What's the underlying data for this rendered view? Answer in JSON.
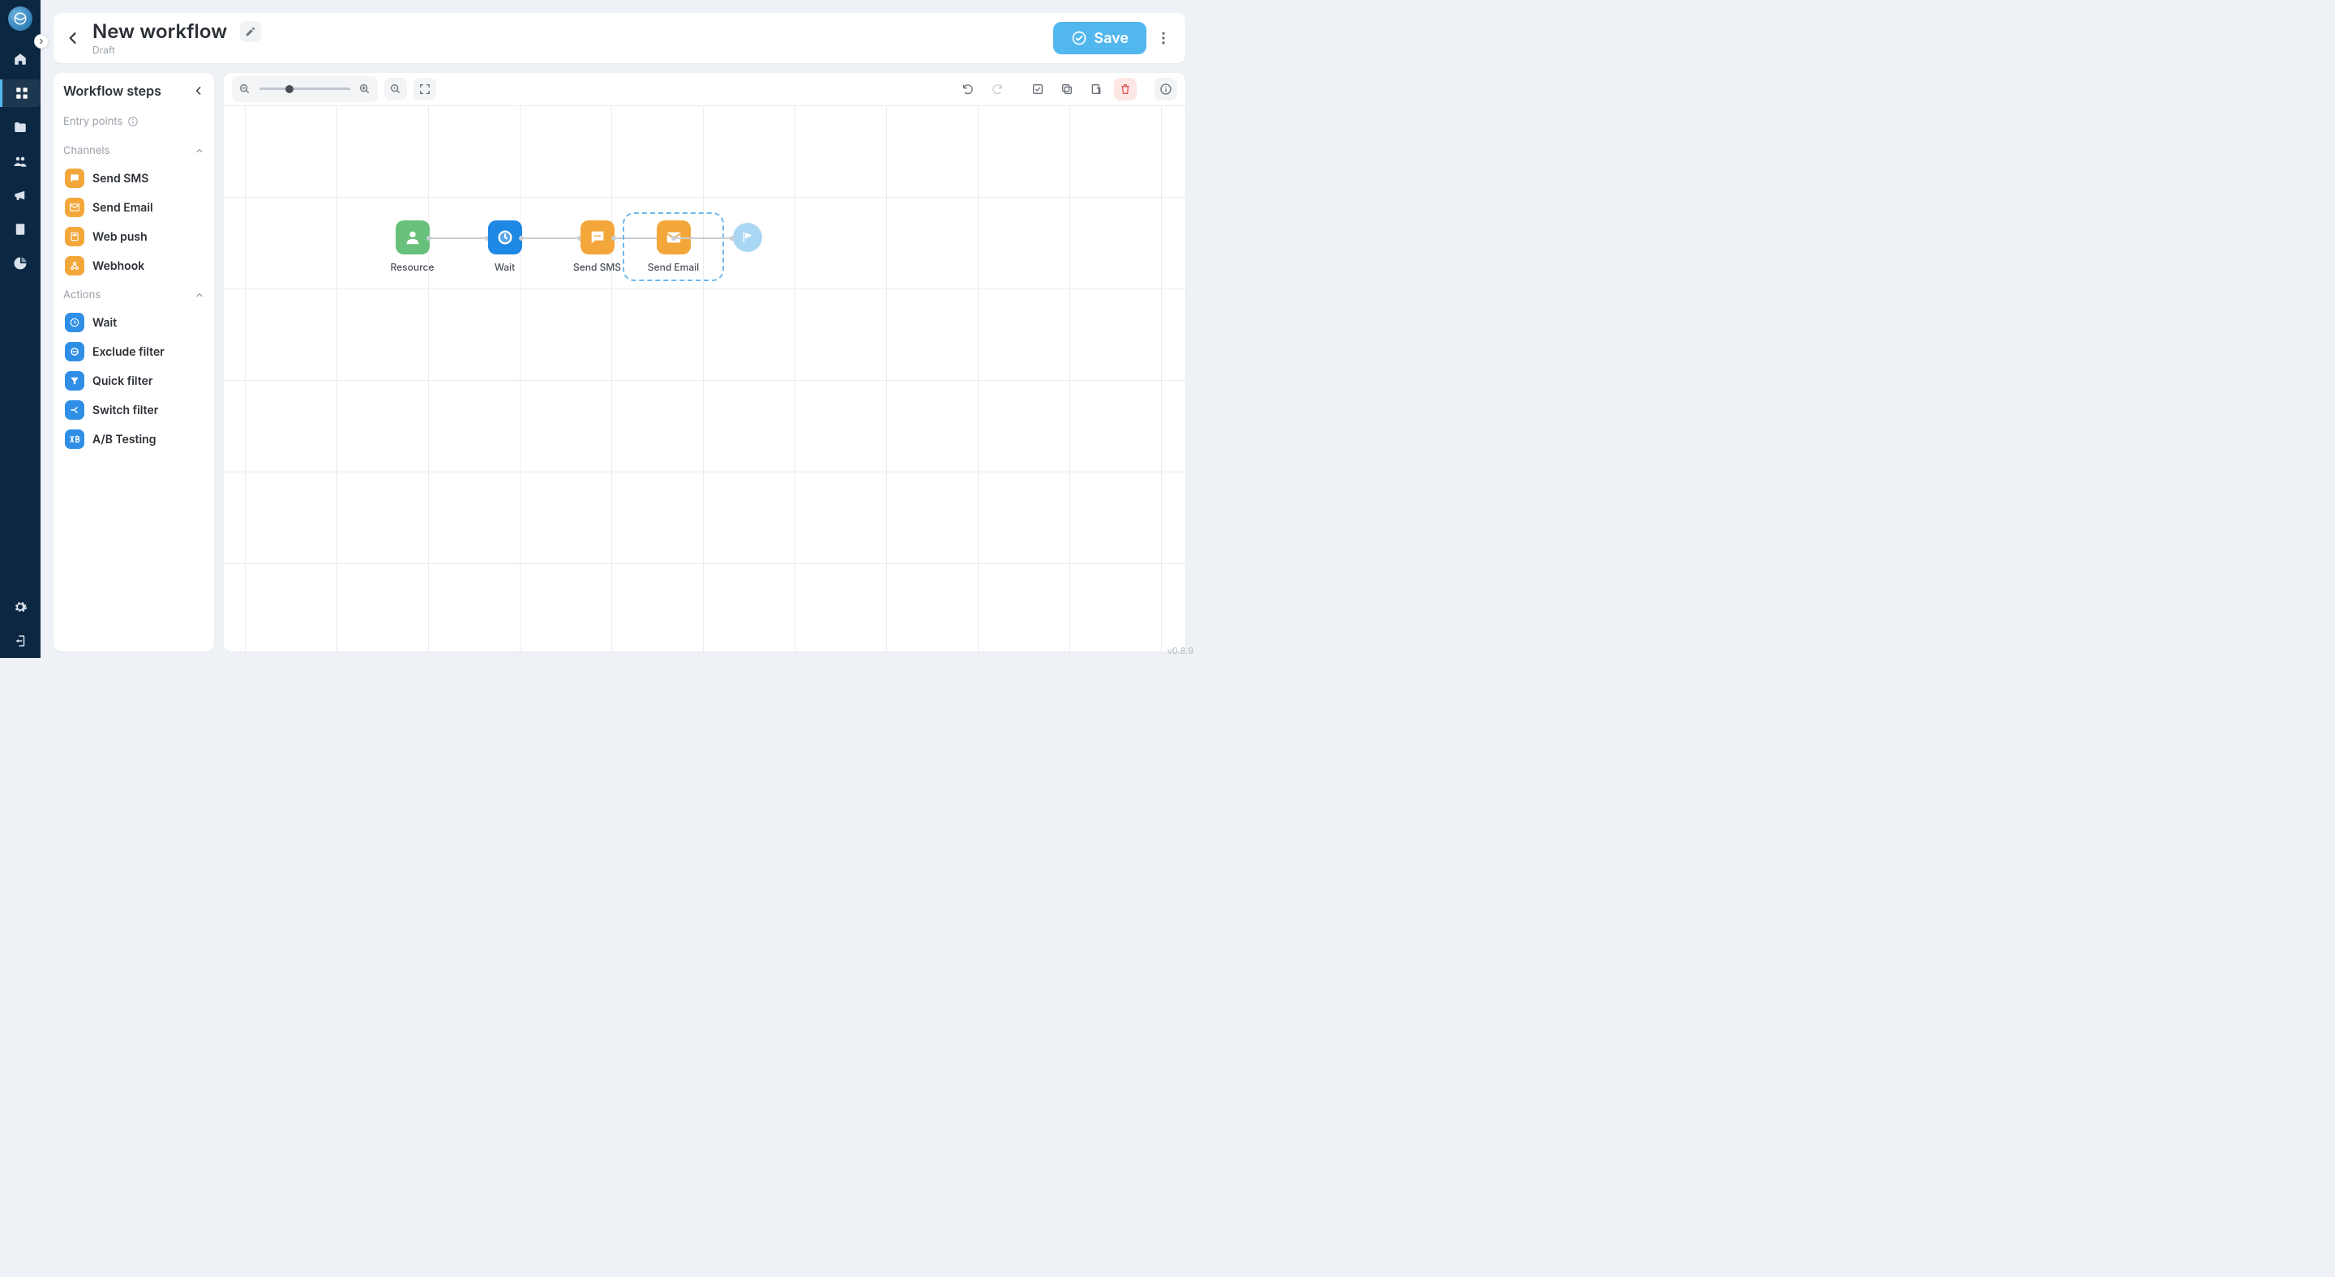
{
  "header": {
    "title": "New workflow",
    "status": "Draft",
    "save_label": "Save"
  },
  "sidepanel": {
    "title": "Workflow steps",
    "entry_points_label": "Entry points",
    "channels_label": "Channels",
    "actions_label": "Actions",
    "channels": [
      {
        "label": "Send SMS",
        "icon": "sms-icon"
      },
      {
        "label": "Send Email",
        "icon": "email-icon"
      },
      {
        "label": "Web push",
        "icon": "webpush-icon"
      },
      {
        "label": "Webhook",
        "icon": "webhook-icon"
      }
    ],
    "actions": [
      {
        "label": "Wait",
        "icon": "clock-icon"
      },
      {
        "label": "Exclude filter",
        "icon": "exclude-icon"
      },
      {
        "label": "Quick filter",
        "icon": "filter-icon"
      },
      {
        "label": "Switch filter",
        "icon": "switch-icon"
      },
      {
        "label": "A/B Testing",
        "icon": "ab-icon"
      }
    ]
  },
  "canvas": {
    "nodes": [
      {
        "label": "Resource",
        "kind": "resource"
      },
      {
        "label": "Wait",
        "kind": "wait"
      },
      {
        "label": "Send SMS",
        "kind": "sms"
      },
      {
        "label": "Send Email",
        "kind": "email",
        "selected": true
      }
    ]
  },
  "app": {
    "version": "v0.8.9"
  }
}
